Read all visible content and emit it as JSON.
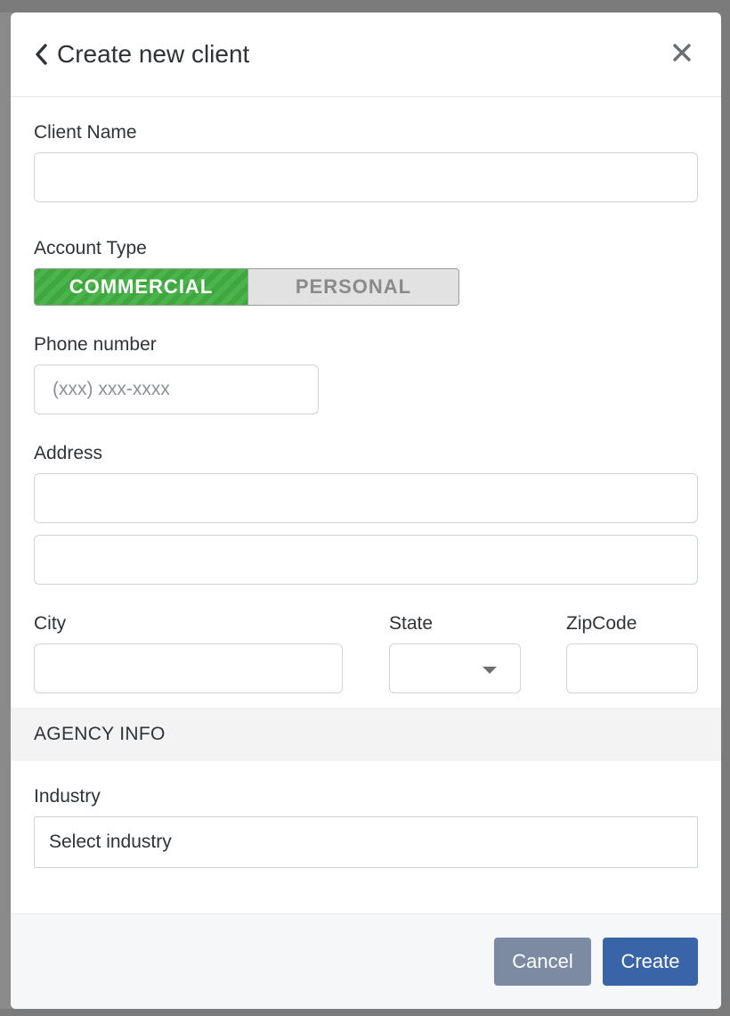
{
  "modal": {
    "title": "Create new client",
    "close_icon": "close-icon",
    "back_icon": "chevron-left-icon"
  },
  "form": {
    "client_name": {
      "label": "Client Name",
      "value": ""
    },
    "account_type": {
      "label": "Account Type",
      "options": [
        "COMMERCIAL",
        "PERSONAL"
      ],
      "selected": "COMMERCIAL"
    },
    "phone": {
      "label": "Phone number",
      "placeholder": "(xxx) xxx-xxxx",
      "value": ""
    },
    "address": {
      "label": "Address",
      "line1": "",
      "line2": ""
    },
    "city": {
      "label": "City",
      "value": ""
    },
    "state": {
      "label": "State",
      "value": ""
    },
    "zipcode": {
      "label": "ZipCode",
      "value": ""
    }
  },
  "agency_info": {
    "heading": "AGENCY INFO",
    "industry": {
      "label": "Industry",
      "placeholder": "Select industry"
    }
  },
  "footer": {
    "cancel_label": "Cancel",
    "create_label": "Create"
  },
  "colors": {
    "toggle_active": "#44ad45",
    "create_button": "#3a64a8",
    "cancel_button": "#7c8ba2",
    "overlay": "#7b7b7b"
  }
}
